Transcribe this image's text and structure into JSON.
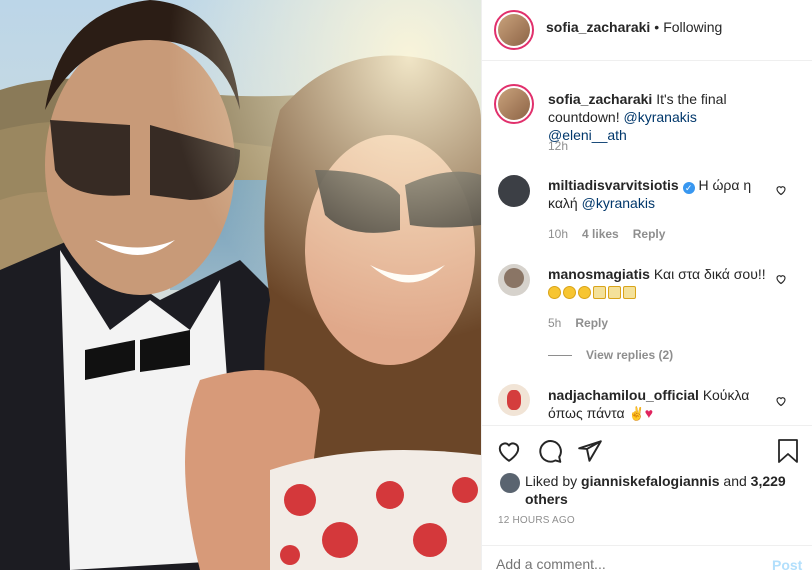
{
  "post": {
    "author": "sofia_zacharaki",
    "follow_status": "Following",
    "caption_text": "It's the final countdown!",
    "caption_mentions": [
      "@kyranakis",
      "@eleni__ath"
    ],
    "caption_time": "12h"
  },
  "comments": [
    {
      "username": "miltiadisvarvitsiotis",
      "verified": true,
      "text": "Η ώρα η καλή",
      "mention": "@kyranakis",
      "time": "10h",
      "likes": "4 likes",
      "reply": "Reply"
    },
    {
      "username": "manosmagiatis",
      "text": "Και στα δικά σου!!",
      "time": "5h",
      "reply": "Reply",
      "view_replies": "View replies (2)"
    },
    {
      "username": "nadjachamilou_official",
      "text": "Κούκλα όπως πάντα"
    }
  ],
  "likes": {
    "prefix": "Liked by",
    "user": "gianniskefalogiannis",
    "suffix": "and",
    "others": "3,229 others"
  },
  "timestamp": "12 HOURS AGO",
  "comment_box": {
    "placeholder": "Add a comment...",
    "post_label": "Post"
  },
  "colors": {
    "link": "#00376b",
    "verified": "#3897f0",
    "muted": "#8e8e8e",
    "post_btn": "#b2dffc"
  }
}
